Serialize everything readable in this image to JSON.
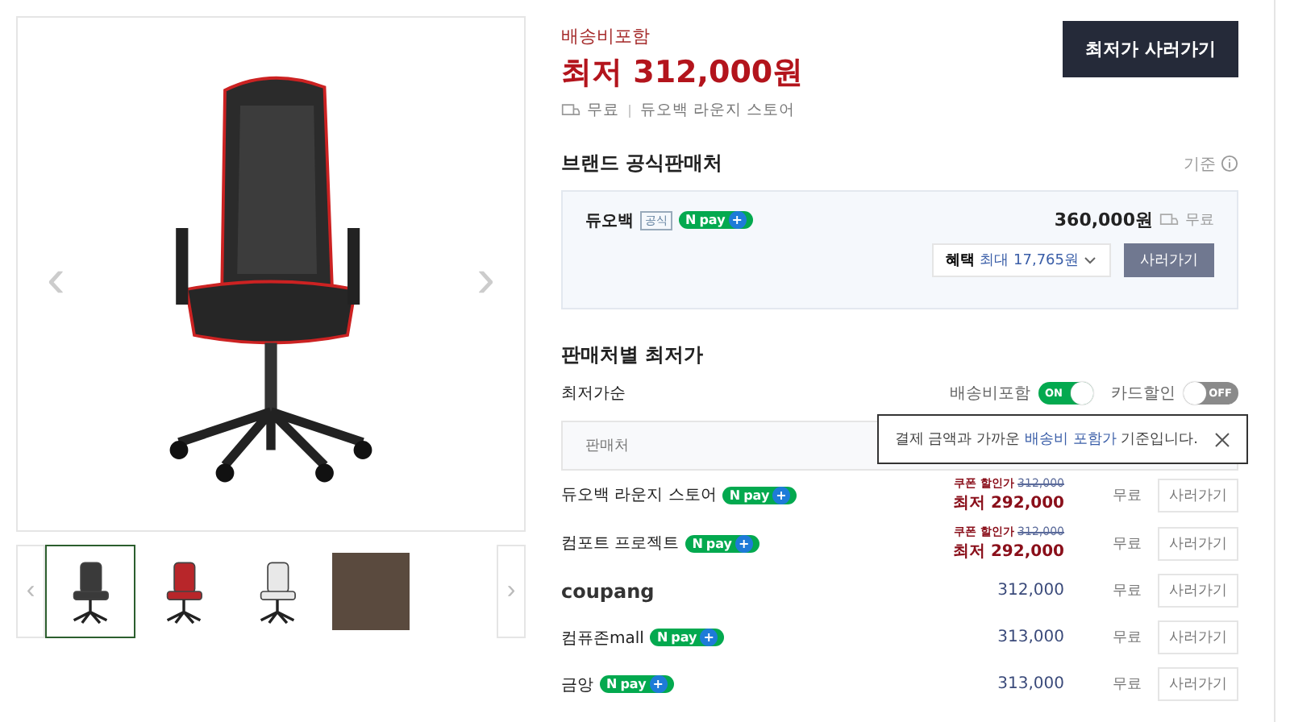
{
  "gallery": {
    "prev": "‹",
    "next": "›",
    "thumb_prev": "‹",
    "thumb_next": "›",
    "thumbnails": [
      {
        "kind": "chair",
        "color": "#3a3a3a",
        "selected": true
      },
      {
        "kind": "chair",
        "color": "#b8262a",
        "selected": false
      },
      {
        "kind": "chair",
        "color": "#e8e8e8",
        "selected": false
      },
      {
        "kind": "photo",
        "selected": false
      }
    ]
  },
  "price": {
    "shipping_note": "배송비포함",
    "amount": "최저 312,000원",
    "shipping": "무료",
    "store": "듀오백 라운지 스토어",
    "buy_button": "최저가 사러가기"
  },
  "official": {
    "title": "브랜드 공식판매처",
    "criteria": "기준",
    "seller": "듀오백",
    "badge": "공식",
    "npay": {
      "mark": "N",
      "text": "pay",
      "plus": "+"
    },
    "price": "360,000원",
    "shipping": "무료",
    "benefit_label": "혜택",
    "benefit_value": "최대 17,765원",
    "buy_button": "사러가기"
  },
  "sellers": {
    "title": "판매처별 최저가",
    "sort": "최저가순",
    "toggles": [
      {
        "label": "배송비포함",
        "on": true,
        "state_text": "ON"
      },
      {
        "label": "카드할인",
        "on": false,
        "state_text": "OFF"
      }
    ],
    "tooltip": {
      "before": "결제 금액과 가까운 ",
      "highlight": "배송비 포함가",
      "after": " 기준입니다."
    },
    "column": "판매처",
    "rows": [
      {
        "kind": "coupon",
        "name": "듀오백 라운지 스토어",
        "npay": {
          "mark": "N",
          "text": "pay",
          "plus": "+"
        },
        "coupon_label": "쿠폰 할인가",
        "original": "312,000",
        "lowest": "최저 292,000",
        "shipping": "무료",
        "button": "사러가기"
      },
      {
        "kind": "coupon",
        "name": "컴포트 프로젝트",
        "npay": {
          "mark": "N",
          "text": "pay",
          "plus": "+"
        },
        "coupon_label": "쿠폰 할인가",
        "original": "312,000",
        "lowest": "최저 292,000",
        "shipping": "무료",
        "button": "사러가기"
      },
      {
        "kind": "logo",
        "name": "coupang",
        "price": "312,000",
        "shipping": "무료",
        "button": "사러가기"
      },
      {
        "kind": "plain",
        "name": "컴퓨존mall",
        "npay": {
          "mark": "N",
          "text": "pay",
          "plus": "+"
        },
        "price": "313,000",
        "shipping": "무료",
        "button": "사러가기"
      },
      {
        "kind": "plain",
        "name": "금앙",
        "npay": {
          "mark": "N",
          "text": "pay",
          "plus": "+"
        },
        "price": "313,000",
        "shipping": "무료",
        "button": "사러가기"
      }
    ]
  }
}
